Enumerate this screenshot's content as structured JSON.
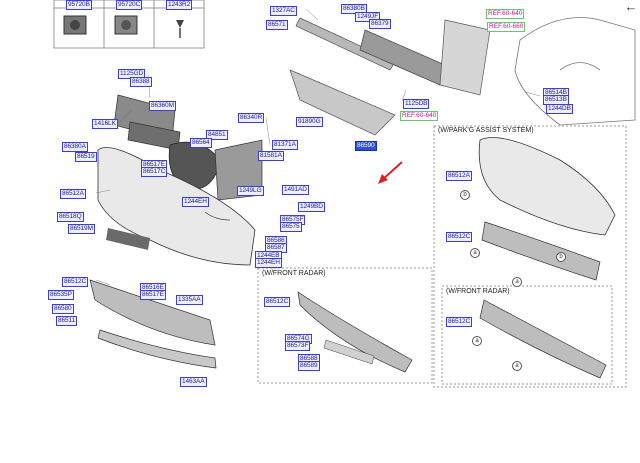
{
  "top_table": {
    "labels": [
      "95720B",
      "95720C",
      "1243R2"
    ]
  },
  "sections": {
    "parking_assist": "(W/PARK'G ASSIST SYSTEM)",
    "front_radar_1": "(W/FRONT RADAR)",
    "front_radar_2": "(W/FRONT RADAR)"
  },
  "circle_markers": {
    "a": "a",
    "b": "b"
  },
  "labels": {
    "l1327ac": "1327AC",
    "l86571": "86571",
    "l86380": "86380B",
    "l1249jf": "1249JF",
    "l86379": "86379",
    "l1125gd": "1125GD",
    "l86388": "86388",
    "l86360m": "86360M",
    "l1416lk": "1416LK",
    "l86380a": "86380A",
    "l86519": "86519",
    "l86517e": "86517E",
    "l86517c": "86517C",
    "l86512a": "86512A",
    "l86518q": "86518Q",
    "l86519m": "86519M",
    "l1244eh": "1244EH",
    "l86340r": "86340R",
    "l84851": "84851",
    "l86564": "86564",
    "l91890g": "91890G",
    "l81371a": "81371A",
    "l81581a": "81581A",
    "l1249lg": "1249LG",
    "l1491ad": "1491AD",
    "l1249bd": "1249BD",
    "l86575f": "86575F",
    "l86575": "86575",
    "l86586": "86586",
    "l86587": "86587",
    "l1244eb": "1244EB",
    "l1244eh2": "1244EH",
    "l86512c": "86512C",
    "l86535p": "86535P",
    "l86580": "86580",
    "l86511": "86511",
    "l86516e": "86516E",
    "l86517e2": "86517E",
    "l1335aa": "1335AA",
    "l1463aa": "1463AA",
    "l1125db": "1125DB",
    "l86514b": "86514B",
    "l86513b": "86513B",
    "l1244db": "1244DB",
    "l86590": "86590",
    "r_l86512a": "86512A",
    "r_l86512c": "86512C",
    "r_l86512c2": "86512C",
    "m_l86512c": "86512C",
    "m_l86574g": "86574G",
    "m_l86573f": "86573F",
    "m_l86588": "86588",
    "m_l86589": "86589"
  },
  "refs": {
    "r640": "REF.60-640",
    "r660": "REF.60-660",
    "r64b": "REF.60-640"
  },
  "colors": {
    "label_border": "#3b3be0",
    "label_text": "#1a1aa6",
    "highlight": "#2f4ed8",
    "ref_text": "#c0148a",
    "arrow": "#e02020"
  }
}
